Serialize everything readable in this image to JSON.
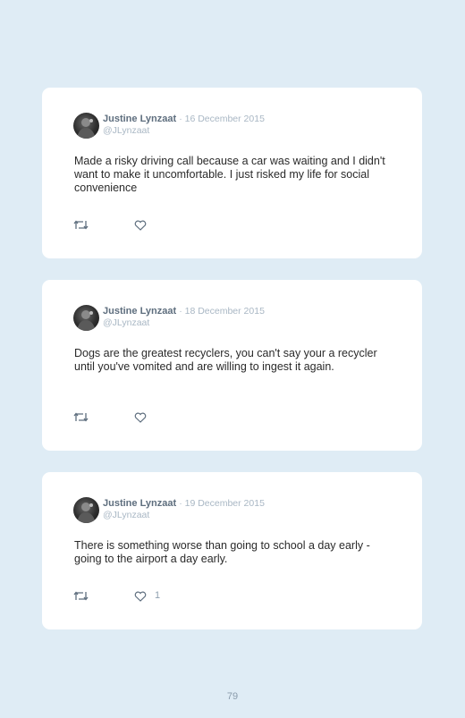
{
  "tweets": [
    {
      "name": "Justine Lynzaat",
      "date": "· 16 December 2015",
      "handle": "@JLynzaat",
      "text": "Made a risky driving call because a car was waiting and I didn't want to make it uncomfortable. I just risked my life for social convenience",
      "like_count": ""
    },
    {
      "name": "Justine Lynzaat",
      "date": "· 18 December 2015",
      "handle": "@JLynzaat",
      "text": "Dogs are the greatest recyclers, you can't say your a recycler until you've vomited and are willing to ingest it again.",
      "like_count": ""
    },
    {
      "name": "Justine Lynzaat",
      "date": "· 19 December 2015",
      "handle": "@JLynzaat",
      "text": "There is something worse than going to school a day early - going to the airport a day early.",
      "like_count": "1"
    }
  ],
  "icons": {
    "retweet": "retweet-icon",
    "like": "heart-icon"
  },
  "page_number": "79"
}
